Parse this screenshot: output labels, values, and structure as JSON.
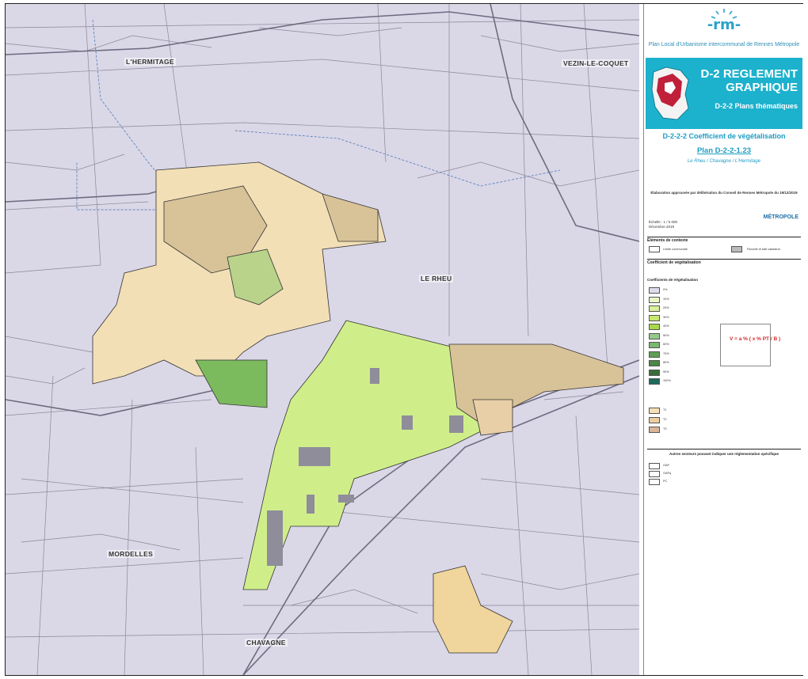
{
  "map": {
    "places": [
      {
        "key": "hermitage",
        "label": "L'HERMITAGE"
      },
      {
        "key": "vezin",
        "label": "VEZIN-LE-COQUET"
      },
      {
        "key": "rheu",
        "label": "LE RHEU"
      },
      {
        "key": "mordelles",
        "label": "MORDELLES"
      },
      {
        "key": "chavagne",
        "label": "CHAVAGNE"
      }
    ]
  },
  "panel": {
    "logo": "-rm-",
    "plu_title": "Plan Local d'Urbanisme intercommunal de Rennes Métropole",
    "banner_title": "D-2 REGLEMENT GRAPHIQUE",
    "banner_sub": "D-2-2 Plans thématiques",
    "theme": "D-2-2-2 Coefficient de végétalisation",
    "plan": "Plan D-2-2-1.23",
    "communes": "Le Rheu / Chavagne / L'Hermitage",
    "approved": "Élaboration approuvée par délibération du Conseil de Rennes Métropole du 19/12/2019",
    "scale": "Échelle : 1 / 5 000",
    "date": "Décembre 2019",
    "metro_logo": "MÉTROPOLE",
    "sec_elements": "Éléments de contexte",
    "lbl_limite": "Limite communale",
    "lbl_parcelle": "Parcelle et bâti cadastral",
    "sec_coef": "Coefficient de végétalisation",
    "sec_coef_list": "Coefficients de Végétalisation",
    "legend_items": [
      {
        "code": "0%",
        "color": "#dcdcec"
      },
      {
        "code": "10%",
        "color": "#e9f7c6"
      },
      {
        "code": "20%",
        "color": "#d9f09c"
      },
      {
        "code": "30%",
        "color": "#c6e86e"
      },
      {
        "code": "40%",
        "color": "#a9d94a"
      },
      {
        "code": "50%",
        "color": "#95c98a"
      },
      {
        "code": "60%",
        "color": "#7ab86f"
      },
      {
        "code": "70%",
        "color": "#5f9f55"
      },
      {
        "code": "80%",
        "color": "#4b8646"
      },
      {
        "code": "90%",
        "color": "#3b6d3a"
      },
      {
        "code": "100%",
        "color": "#1e6a5c"
      }
    ],
    "formula": "V = a % ( x % PT / B )",
    "autres": "Autres secteurs pouvant indiquer une réglementation spécifique",
    "t_items": [
      {
        "code": "T1",
        "color": "#f6dfb8"
      },
      {
        "code": "T2",
        "color": "#eccda0"
      },
      {
        "code": "T3",
        "color": "#d9b59a"
      }
    ],
    "other_items": [
      {
        "code": "OAP",
        "color": "#ffffff"
      },
      {
        "code": "OAPq",
        "color": "#ffffff"
      },
      {
        "code": "PC",
        "color": "#ffffff"
      }
    ]
  }
}
